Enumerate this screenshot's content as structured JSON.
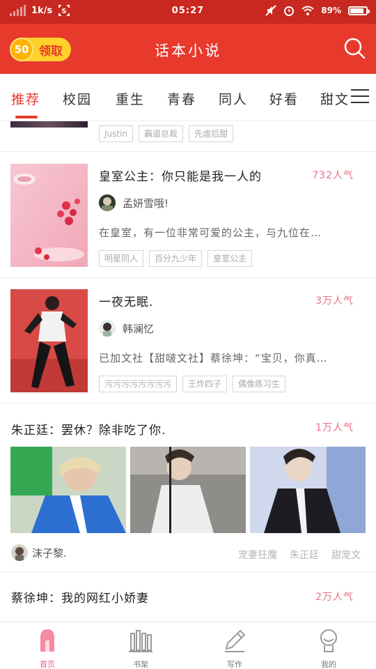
{
  "status_bar": {
    "speed": "1k/s",
    "time": "05:27",
    "battery": "89%"
  },
  "header": {
    "coin_value": "50",
    "coin_label": "领取",
    "title": "话本小说"
  },
  "tabs": [
    "推荐",
    "校园",
    "重生",
    "青春",
    "同人",
    "好看",
    "甜文"
  ],
  "partial_tags": [
    "Justin",
    "霸道总裁",
    "先虐后甜"
  ],
  "books": [
    {
      "title": "皇室公主：你只能是我一人的",
      "popularity": "732人气",
      "author": "孟妍雪哦!",
      "description": "在皇室，有一位非常可爱的公主，与九位在…",
      "tags": [
        "明星同人",
        "百分九少年",
        "皇室公主"
      ]
    },
    {
      "title": "一夜无眠.",
      "popularity": "3万人气",
      "author": "韩澜忆",
      "description": "已加文社【甜啵文社】蔡徐坤：“宝贝，你真…",
      "tags": [
        "污污污污污污污污",
        "王炸四子",
        "偶像练习生"
      ]
    }
  ],
  "feature": {
    "title": "朱正廷：罢休？除非吃了你.",
    "popularity": "1万人气",
    "author": "沫子黎.",
    "tags": [
      "宠妻狂魔",
      "朱正廷",
      "甜宠文"
    ]
  },
  "feature2": {
    "title": "蔡徐坤：我的网红小娇妻",
    "popularity": "2万人气"
  },
  "bottom_nav": [
    "首页",
    "书架",
    "写作",
    "我的"
  ]
}
